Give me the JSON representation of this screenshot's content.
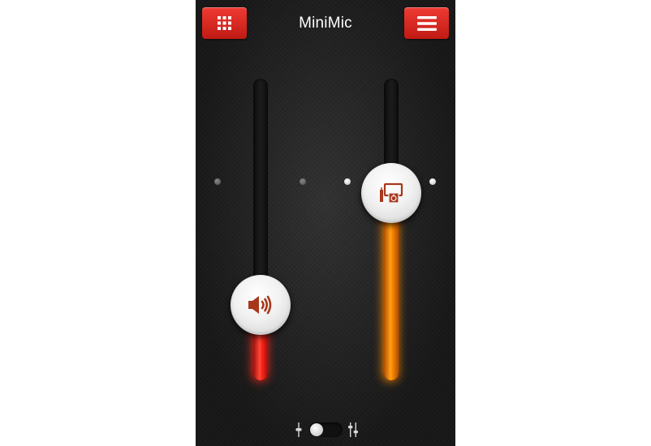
{
  "header": {
    "title": "MiniMic",
    "left_button_icon": "grid-icon",
    "right_button_icon": "hamburger-menu-icon"
  },
  "sliders": [
    {
      "name": "speaker-volume",
      "icon": "speaker-icon",
      "level_fraction": 0.25,
      "color": "#ff2a1c"
    },
    {
      "name": "output-device",
      "icon": "monitor-speaker-icon",
      "level_fraction": 0.62,
      "color": "#ff8a00"
    }
  ],
  "footer": {
    "toggle_state": "off",
    "left_icon": "single-slider-icon",
    "right_icon": "dual-slider-icon"
  },
  "colors": {
    "accent_red": "#d42a22",
    "accent_orange": "#ff8a00",
    "icon_brown": "#a8381c"
  }
}
